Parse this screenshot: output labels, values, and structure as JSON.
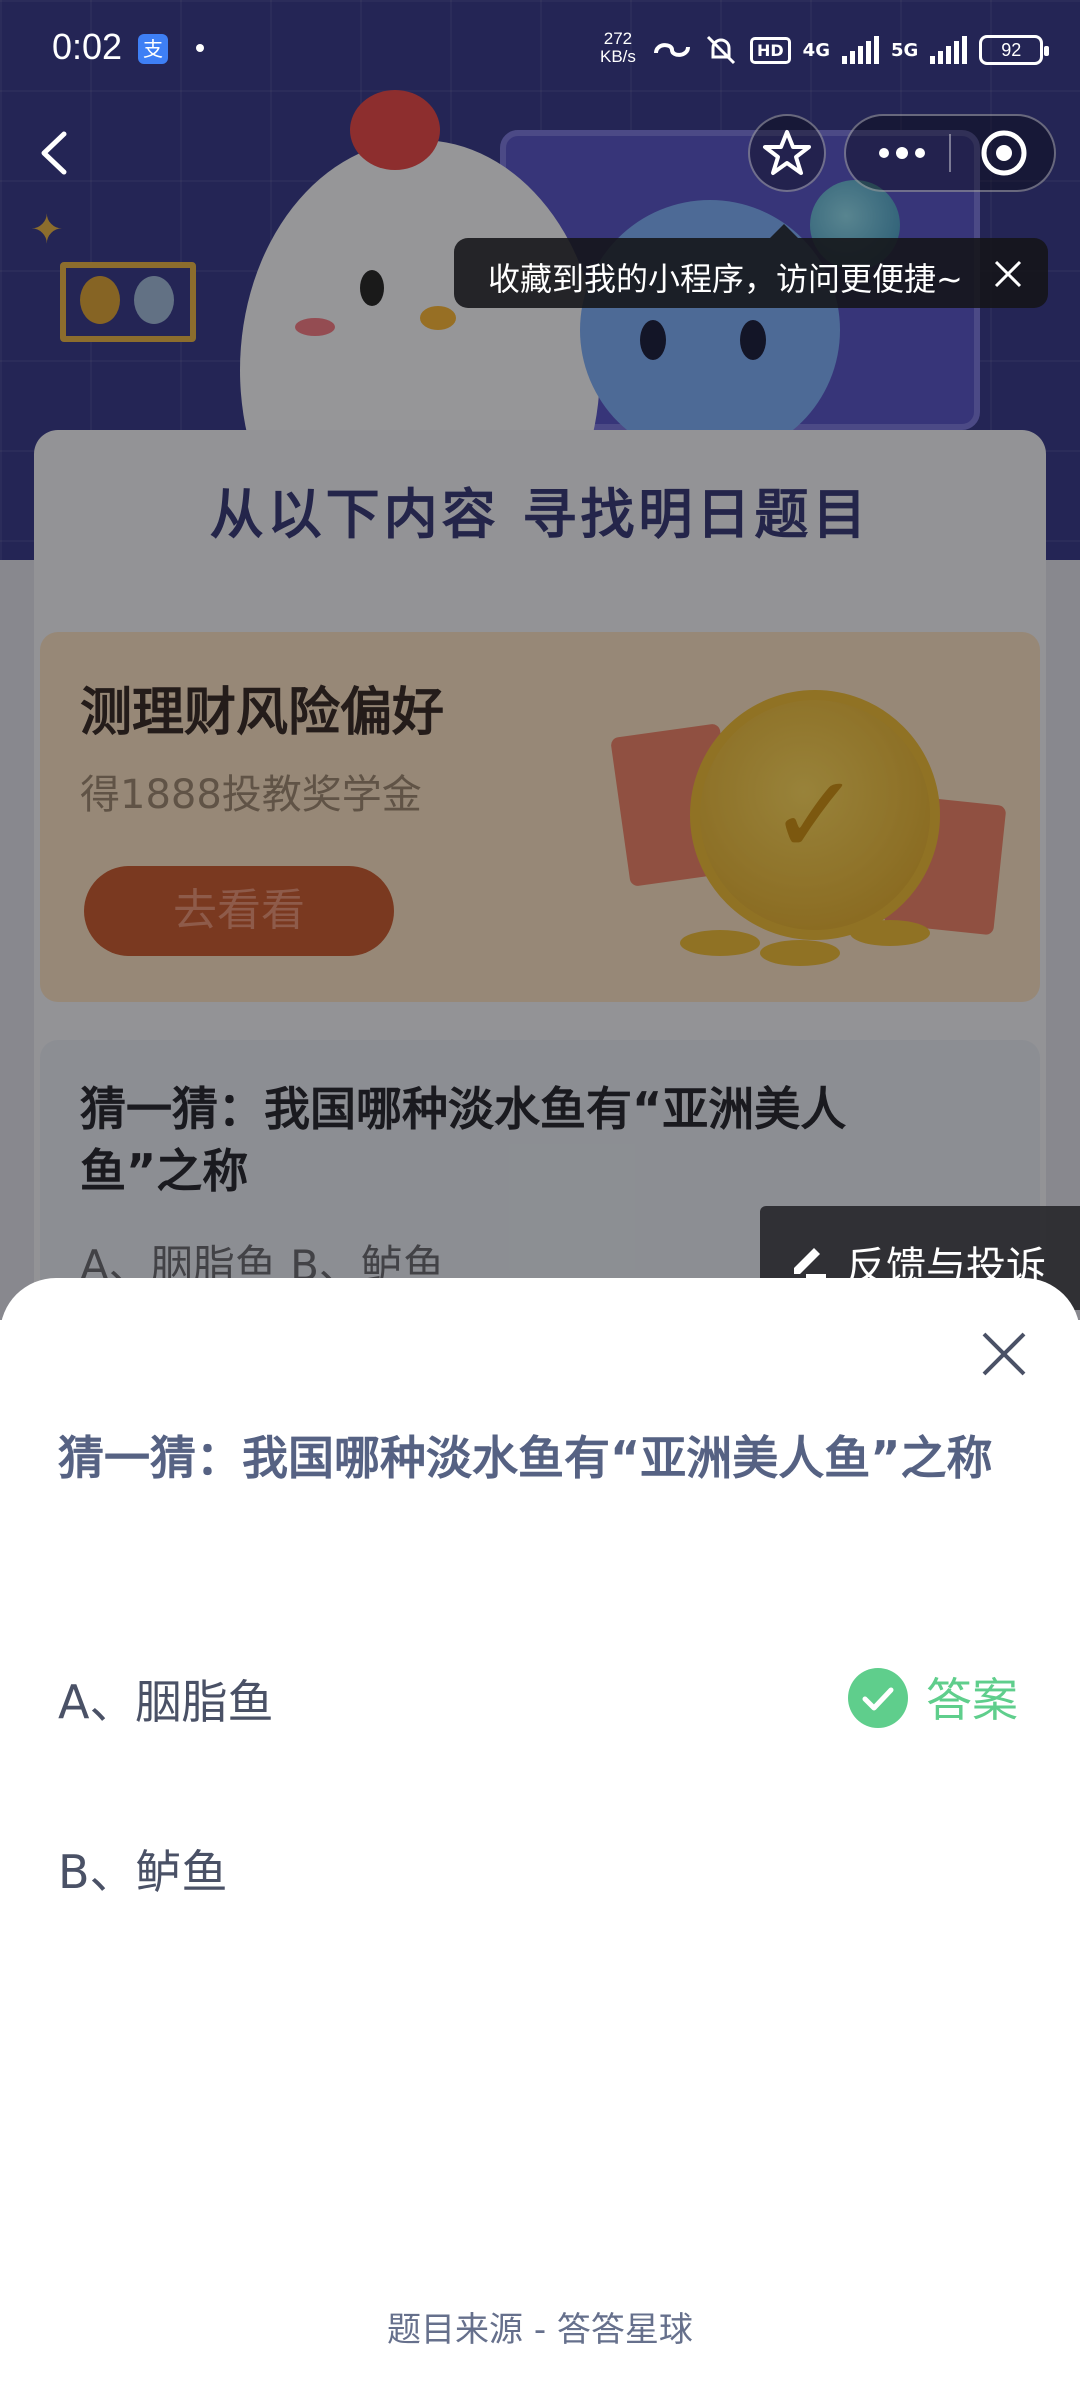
{
  "status_bar": {
    "time": "0:02",
    "app_icon_text": "支",
    "net_speed": "272",
    "net_speed_unit": "KB/s",
    "hd_label": "HD",
    "network_1": "4G",
    "network_2": "5G",
    "battery": "92"
  },
  "nav": {
    "back_icon": "back-arrow-icon",
    "favorite_icon": "star-icon",
    "more_icon": "more-dots-icon",
    "home_icon": "target-icon"
  },
  "tooltip": {
    "text": "收藏到我的小程序，访问更便捷~"
  },
  "page": {
    "section_title": "从以下内容 寻找明日题目",
    "promo": {
      "title": "测理财风险偏好",
      "subtitle": "得1888投教奖学金",
      "button": "去看看"
    },
    "quiz_card": {
      "question": "猜一猜：我国哪种淡水鱼有“亚洲美人鱼”之称",
      "options_preview": "A、胭脂鱼    B、鲈鱼"
    },
    "feedback": "反馈与投诉"
  },
  "sheet": {
    "question": "猜一猜：我国哪种淡水鱼有“亚洲美人鱼”之称",
    "options": [
      {
        "label": "A、胭脂鱼",
        "is_answer": true
      },
      {
        "label": "B、鲈鱼",
        "is_answer": false
      }
    ],
    "answer_label": "答案",
    "source": "题目来源 - 答答星球"
  },
  "colors": {
    "accent_green": "#5fce8c",
    "question_text": "#566283",
    "hero_bg": "#3a3d8a"
  }
}
